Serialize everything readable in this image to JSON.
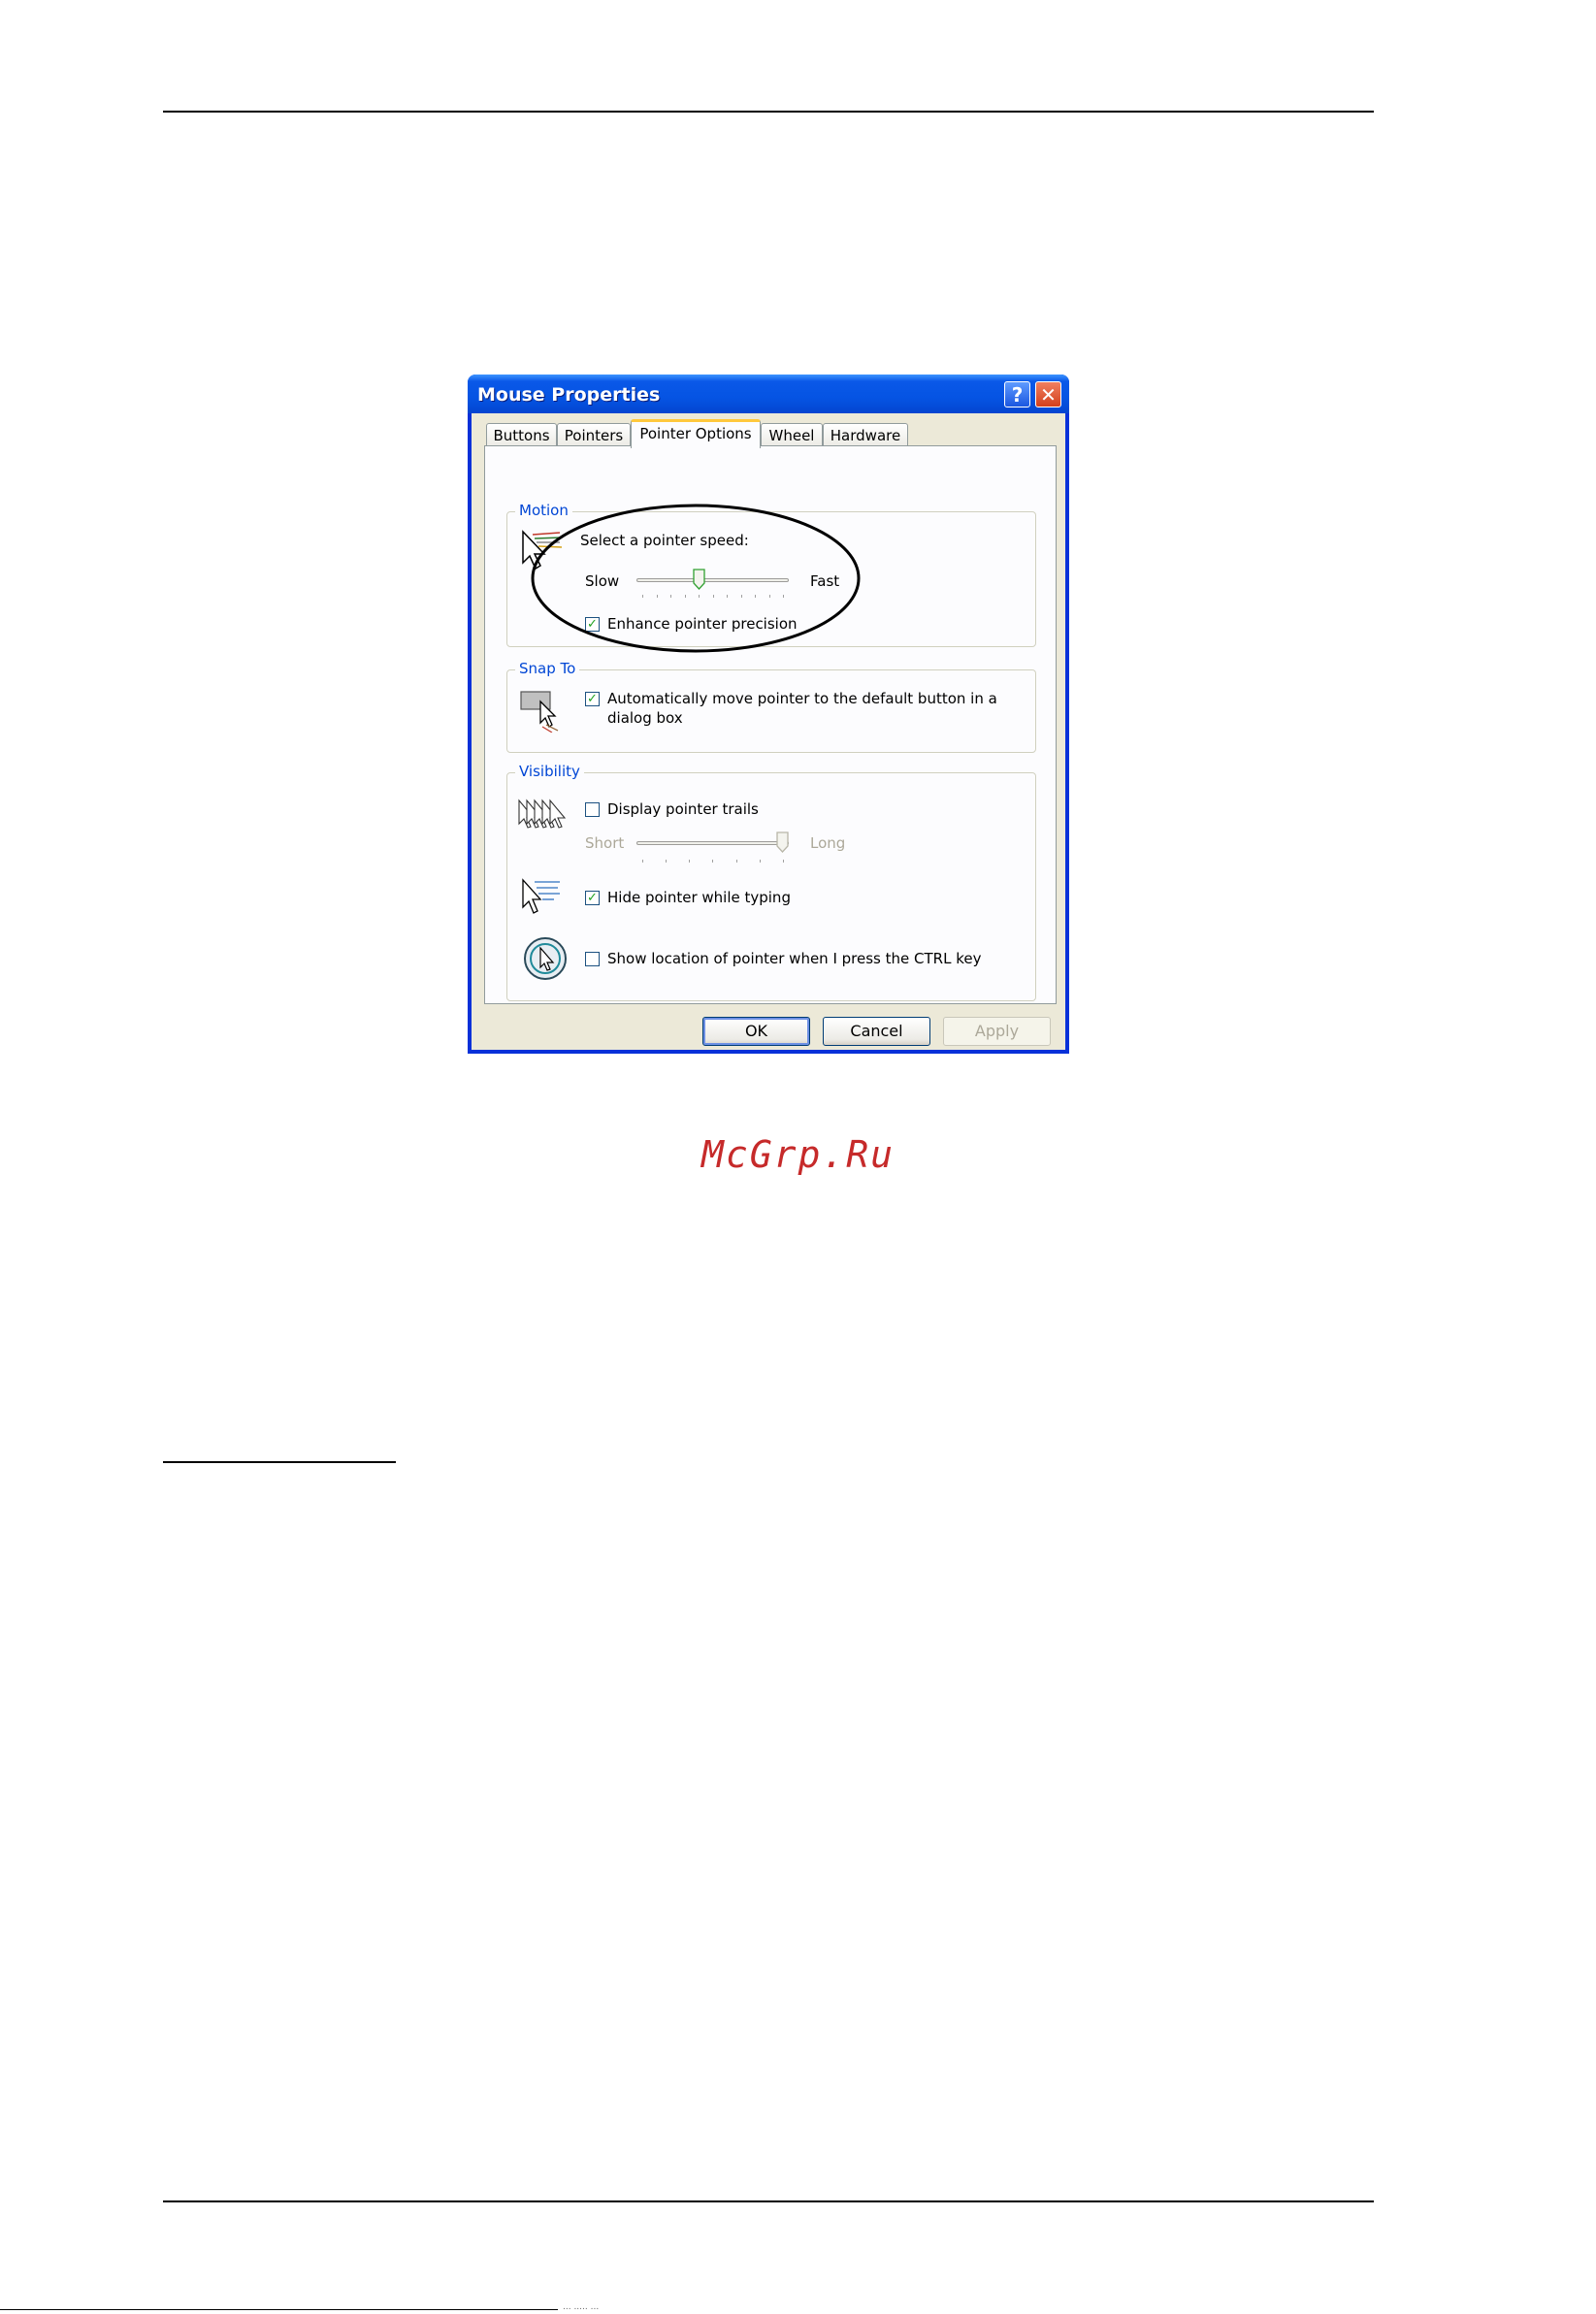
{
  "dialog": {
    "title": "Mouse Properties",
    "help_glyph": "?",
    "close_glyph": "✕",
    "tabs": [
      {
        "label": "Buttons",
        "active": false
      },
      {
        "label": "Pointers",
        "active": false
      },
      {
        "label": "Pointer Options",
        "active": true
      },
      {
        "label": "Wheel",
        "active": false
      },
      {
        "label": "Hardware",
        "active": false
      }
    ],
    "motion": {
      "title": "Motion",
      "speed_label": "Select a pointer speed:",
      "slow_label": "Slow",
      "fast_label": "Fast",
      "speed_level": 0.4,
      "enhance_label": "Enhance pointer precision",
      "enhance_checked": true
    },
    "snap_to": {
      "title": "Snap To",
      "auto_label_line1": "Automatically move pointer to the default button in a",
      "auto_label_line2": "dialog box",
      "auto_checked": true
    },
    "visibility": {
      "title": "Visibility",
      "trails_label": "Display pointer trails",
      "trails_checked": false,
      "short_label": "Short",
      "long_label": "Long",
      "trail_level": 1.0,
      "hide_label": "Hide pointer while typing",
      "hide_checked": true,
      "ctrl_label": "Show location of pointer when I press the CTRL key",
      "ctrl_checked": false
    },
    "buttons": {
      "ok": "OK",
      "cancel": "Cancel",
      "apply": "Apply"
    },
    "check_glyph": "✓"
  },
  "watermark": "McGrp.Ru",
  "footer_text": "... ..... ..."
}
